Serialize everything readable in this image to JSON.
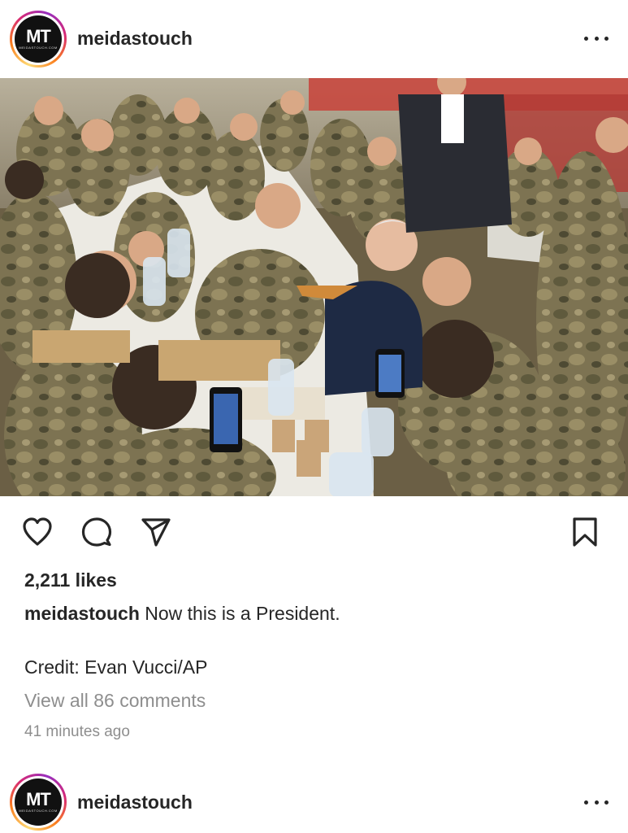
{
  "post": {
    "username": "meidastouch",
    "avatar": {
      "logo_text": "MT",
      "logo_subtext": "MEIDASTOUCH.COM"
    },
    "photo": {
      "alt": ""
    },
    "actions": {
      "like_icon": "heart-icon",
      "comment_icon": "comment-icon",
      "share_icon": "paper-plane-icon",
      "save_icon": "bookmark-icon"
    },
    "likes": "2,211 likes",
    "caption": {
      "user": "meidastouch",
      "text": "Now this is a President."
    },
    "credit": "Credit: Evan Vucci/AP",
    "view_comments": "View all 86 comments",
    "timestamp": "41 minutes ago"
  },
  "next_post": {
    "username": "meidastouch",
    "avatar": {
      "logo_text": "MT",
      "logo_subtext": "MEIDASTOUCH.COM"
    }
  },
  "colors": {
    "text": "#262626",
    "muted": "#8e8e8e",
    "ring_start": "#feda75",
    "ring_mid": "#d62976",
    "ring_end": "#962fbf"
  }
}
